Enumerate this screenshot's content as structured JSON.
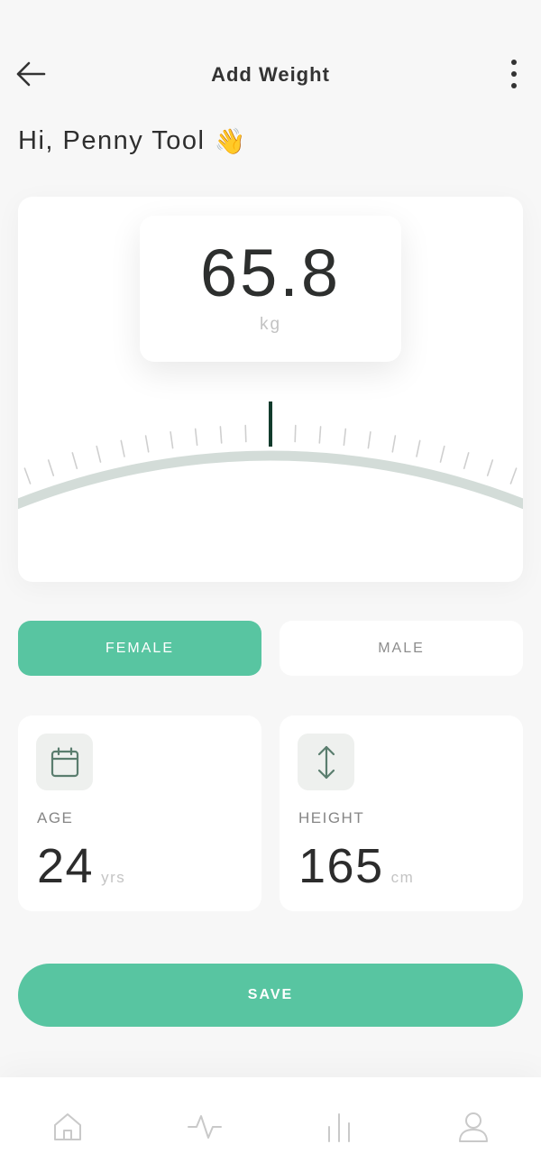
{
  "header": {
    "title": "Add Weight",
    "back_icon": "arrow-left-icon",
    "menu_icon": "more-vertical-icon"
  },
  "greeting": {
    "text": "Hi, Penny Tool",
    "emoji": "👋"
  },
  "scale": {
    "value": "65.8",
    "unit": "kg",
    "indicator_color": "#123b2c",
    "arc_color": "#d3dcd8"
  },
  "gender": {
    "options": [
      "FEMALE",
      "MALE"
    ],
    "selected": "FEMALE"
  },
  "age": {
    "label": "AGE",
    "value": "24",
    "unit": "yrs",
    "icon": "calendar-icon"
  },
  "height": {
    "label": "HEIGHT",
    "value": "165",
    "unit": "cm",
    "icon": "vertical-arrows-icon"
  },
  "save": {
    "label": "SAVE"
  },
  "nav": {
    "items": [
      "home-icon",
      "activity-icon",
      "bar-chart-icon",
      "user-icon"
    ]
  },
  "colors": {
    "accent": "#58c5a1",
    "background": "#f7f7f7",
    "icon_tint": "#5a7d6e"
  }
}
